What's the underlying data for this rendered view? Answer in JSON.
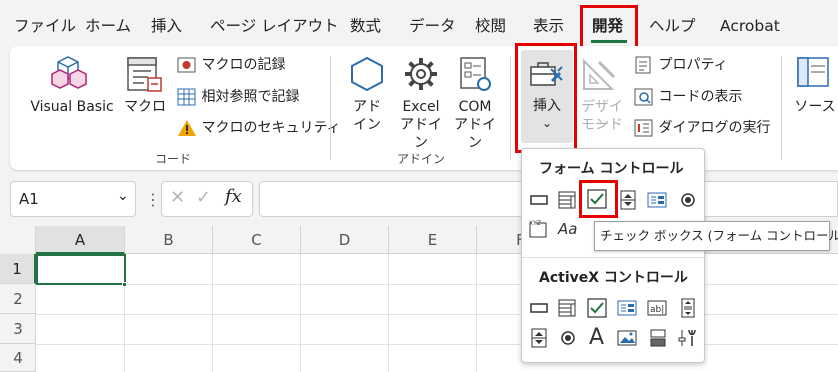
{
  "tabs": [
    {
      "label": "ファイル"
    },
    {
      "label": "ホーム"
    },
    {
      "label": "挿入"
    },
    {
      "label": "ページ レイアウト"
    },
    {
      "label": "数式"
    },
    {
      "label": "データ"
    },
    {
      "label": "校閲"
    },
    {
      "label": "表示"
    },
    {
      "label": "開発",
      "active": true
    },
    {
      "label": "ヘルプ"
    },
    {
      "label": "Acrobat"
    }
  ],
  "ribbon": {
    "code": {
      "group_label": "コード",
      "visual_basic": "Visual Basic",
      "macro": "マクロ",
      "record_macro": "マクロの記録",
      "relative_ref": "相対参照で記録",
      "macro_security": "マクロのセキュリティ"
    },
    "addins": {
      "group_label": "アドイン",
      "addin_l1": "アド",
      "addin_l2": "イン",
      "excel_l1": "Excel",
      "excel_l2": "アドイン",
      "com_l1": "COM",
      "com_l2": "アドイン"
    },
    "controls": {
      "insert": "挿入",
      "design_l1": "デザイン",
      "design_l2": "モード",
      "properties": "プロパティ",
      "view_code": "コードの表示",
      "run_dialog": "ダイアログの実行"
    },
    "xml": {
      "source": "ソース"
    }
  },
  "formula_bar": {
    "name_box": "A1",
    "fx": "fx"
  },
  "columns": [
    "A",
    "B",
    "C",
    "D",
    "E",
    "F"
  ],
  "rows": [
    "1",
    "2",
    "3",
    "4"
  ],
  "popup": {
    "form_header": "フォーム コントロール",
    "activex_header": "ActiveX コントロール",
    "tooltip": "チェック ボックス (フォーム コントロール)",
    "label_icon_text": "Aa",
    "activex_label_text": "A"
  },
  "colors": {
    "accent": "#217346",
    "highlight": "#e60000"
  }
}
